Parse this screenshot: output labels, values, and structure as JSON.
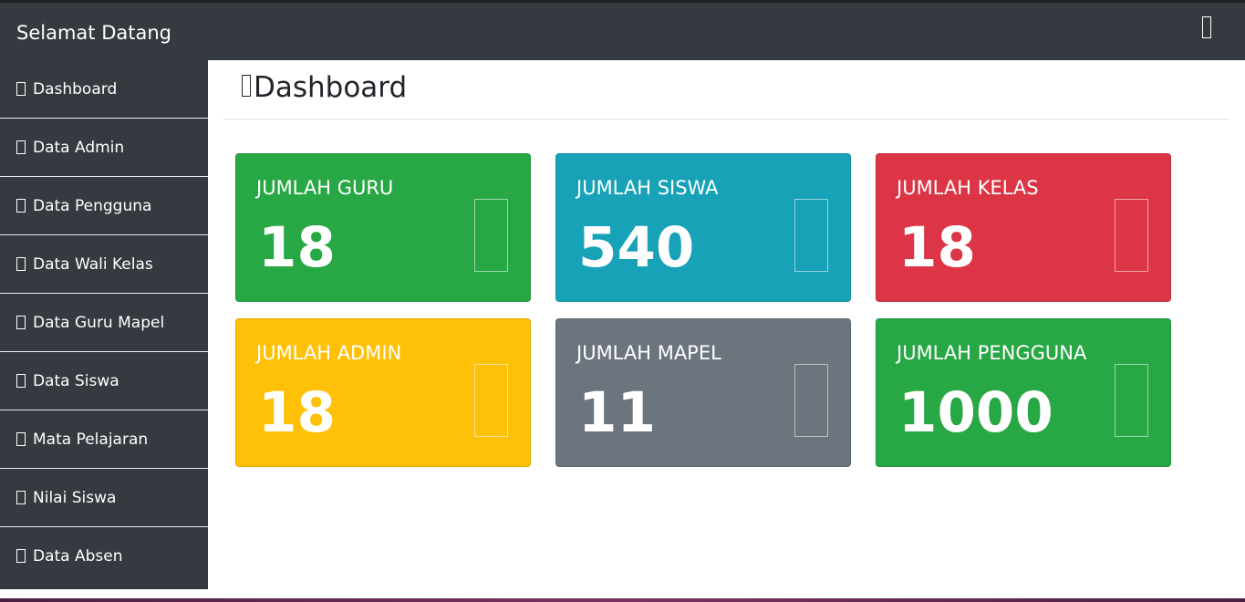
{
  "header": {
    "brand": "Selamat Datang",
    "user_icon": "user-icon"
  },
  "sidebar": {
    "items": [
      {
        "label": "Dashboard",
        "icon": "dashboard-icon"
      },
      {
        "label": "Data Admin",
        "icon": "admin-icon"
      },
      {
        "label": "Data Pengguna",
        "icon": "users-icon"
      },
      {
        "label": "Data Wali Kelas",
        "icon": "teacher-icon"
      },
      {
        "label": "Data Guru Mapel",
        "icon": "teacher-icon"
      },
      {
        "label": "Data Siswa",
        "icon": "student-icon"
      },
      {
        "label": "Mata Pelajaran",
        "icon": "book-icon"
      },
      {
        "label": "Nilai Siswa",
        "icon": "grade-icon"
      },
      {
        "label": "Data Absen",
        "icon": "attendance-icon"
      }
    ]
  },
  "main": {
    "title": "Dashboard",
    "title_icon": "dashboard-icon",
    "cards": [
      {
        "label": "JUMLAH GURU",
        "value": "18",
        "color": "#28a745",
        "icon": "teacher-icon"
      },
      {
        "label": "JUMLAH SISWA",
        "value": "540",
        "color": "#17a2b8",
        "icon": "student-icon"
      },
      {
        "label": "JUMLAH KELAS",
        "value": "18",
        "color": "#dc3545",
        "icon": "class-icon"
      },
      {
        "label": "JUMLAH ADMIN",
        "value": "18",
        "color": "#ffc107",
        "icon": "admin-icon"
      },
      {
        "label": "JUMLAH MAPEL",
        "value": "11",
        "color": "#6c757d",
        "icon": "book-icon"
      },
      {
        "label": "JUMLAH PENGGUNA",
        "value": "1000",
        "color": "#28a745",
        "icon": "users-icon"
      }
    ]
  }
}
